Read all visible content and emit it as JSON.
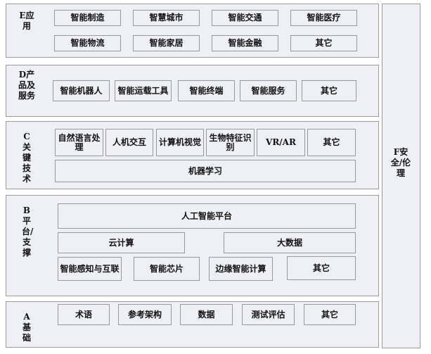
{
  "layers": {
    "E": {
      "label": "E应用",
      "items": [
        "智能制造",
        "智慧城市",
        "智能交通",
        "智能医疗",
        "智能物流",
        "智能家居",
        "智能金融",
        "其它"
      ]
    },
    "D": {
      "label": "D产品及服务",
      "items": [
        "智能机器人",
        "智能运载工具",
        "智能终端",
        "智能服务",
        "其它"
      ]
    },
    "C": {
      "label": "C关键技术",
      "items": [
        "自然语言处理",
        "人机交互",
        "计算机视觉",
        "生物特征识别",
        "VR/AR",
        "其它",
        "机器学习"
      ]
    },
    "B": {
      "label": "B平台/支撑",
      "items": [
        "人工智能平台",
        "云计算",
        "大数据",
        "智能感知与互联",
        "智能芯片",
        "边缘智能计算",
        "其它"
      ]
    },
    "A": {
      "label": "A基础",
      "items": [
        "术语",
        "参考架构",
        "数据",
        "测试评估",
        "其它"
      ]
    }
  },
  "side": {
    "label": "F安全/伦理"
  }
}
